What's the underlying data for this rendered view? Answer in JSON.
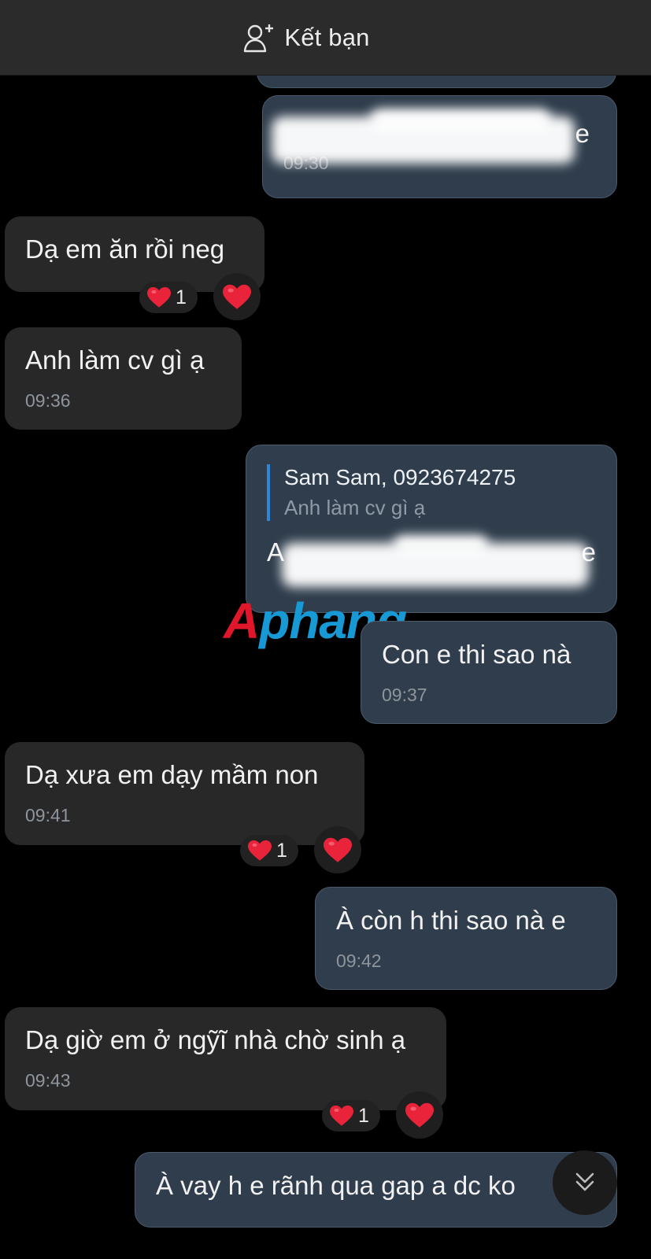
{
  "header": {
    "add_friend_label": "Kết bạn"
  },
  "messages": {
    "m1": {
      "time": "09:30",
      "text_end": "e"
    },
    "m2": {
      "text": "Dạ em ăn rồi neg",
      "reaction_count": "1"
    },
    "m3": {
      "text": "Anh làm cv gì ạ",
      "time": "09:36"
    },
    "m4": {
      "quote_author": "Sam Sam, 0923674275",
      "quote_text": "Anh làm cv gì ạ",
      "text_start": "A",
      "text_end": "e"
    },
    "m5": {
      "text": "Con e thi sao nà",
      "time": "09:37"
    },
    "m6": {
      "text": "Dạ xưa em dạy mầm non",
      "time": "09:41",
      "reaction_count": "1"
    },
    "m7": {
      "text": "À còn h thi sao nà e",
      "time": "09:42"
    },
    "m8": {
      "text": "Dạ giờ em ở ngỹĩ nhà chờ sinh ạ",
      "time": "09:43",
      "reaction_count": "1"
    },
    "m9": {
      "text": "À vay h e rãnh qua gap a dc ko"
    }
  },
  "watermark": {
    "first": "A",
    "rest": "phang"
  },
  "colors": {
    "background": "#000000",
    "incoming_bubble": "#282828",
    "outgoing_bubble": "#2f3d4c",
    "quote_bar": "#2f86d8",
    "heart": "#e8233a"
  },
  "icons": {
    "add_friend": "person-plus-icon",
    "reaction": "heart-icon",
    "scroll": "chevron-double-down-icon"
  }
}
